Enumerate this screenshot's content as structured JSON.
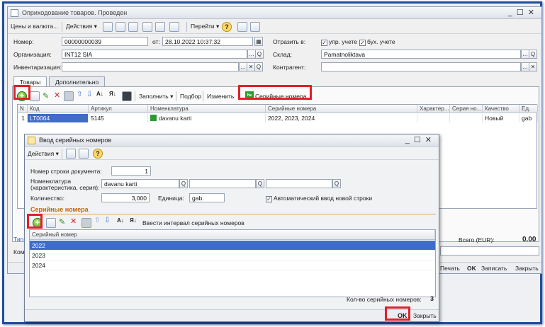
{
  "main_window": {
    "title": "Оприходование товаров. Проведен",
    "toolbar": {
      "prices": "Цены и валюта...",
      "actions": "Действия ▾",
      "goto": "Перейти ▾"
    },
    "fields": {
      "number_label": "Номер:",
      "number_value": "00000000039",
      "date_label": "от:",
      "date_value": "28.10.2022 10:37:32",
      "org_label": "Организация:",
      "org_value": "INT12 SIA",
      "inv_label": "Инвентаризация:",
      "inv_value": "",
      "reflect_label": "Отразить в:",
      "reflect_mgmt": "упр. учете",
      "reflect_acc": "бух. учете",
      "warehouse_label": "Склад:",
      "warehouse_value": "Pamatnoliktava",
      "contractor_label": "Контрагент:",
      "contractor_value": ""
    },
    "tabs": [
      "Товары",
      "Дополнительно"
    ],
    "grid_toolbar": {
      "fill": "Заполнить ▾",
      "select": "Подбор",
      "change": "Изменить",
      "serials": "Серийные номера"
    },
    "grid": {
      "columns": [
        "N",
        "Код",
        "Артикул",
        "Номенклатура",
        "Серийные номера",
        "Характер...",
        "Серия но...",
        "Качество",
        "Ед."
      ],
      "rows": [
        {
          "n": "1",
          "code": "LT0064",
          "article": "5145",
          "nomenclature": "davanu karti",
          "serials": "2022, 2023, 2024",
          "char": "",
          "series": "",
          "quality": "Новый",
          "unit": "gab"
        }
      ]
    },
    "side_labels": {
      "tip": "Тип",
      "kom": "Ком"
    },
    "total_label": "Всего (EUR):",
    "total_value": "0.00",
    "bottom_buttons": {
      "print": "Печать",
      "ok": "OK",
      "save": "Записать",
      "close": "Закрыть"
    }
  },
  "dialog": {
    "title": "Ввод серийных номеров",
    "actions": "Действия ▾",
    "fields": {
      "rownum_label": "Номер строки документа:",
      "rownum_value": "1",
      "nomen_label": "Номенклатура (характеристика, серия):",
      "nomen_value": "davanu karti",
      "nomen_char": "",
      "nomen_series": "",
      "qty_label": "Количество:",
      "qty_value": "3,000",
      "unit_label": "Единица:",
      "unit_value": "gab.",
      "auto_label": "Автоматический ввод новой строки"
    },
    "section_title": "Серийные номера",
    "interval_button": "Ввести интервал серийных номеров",
    "grid": {
      "header": "Серийный номер",
      "rows": [
        "2022",
        "2023",
        "2024"
      ]
    },
    "count_label": "Кол-во серийных номеров:",
    "count_value": "3",
    "ok": "OK",
    "close": "Закрыть"
  },
  "colors": {
    "highlight_red": "#e0202a",
    "selection_blue": "#3f6bc9",
    "frame_blue": "#1f4e9c",
    "section_orange": "#c06800"
  }
}
